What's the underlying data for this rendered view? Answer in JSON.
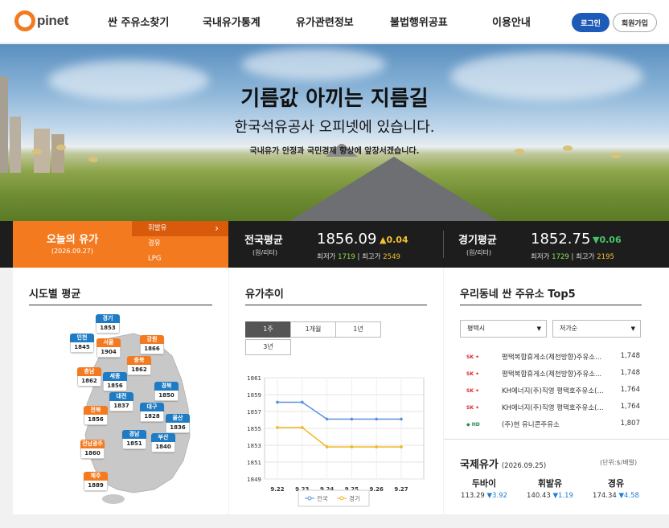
{
  "header": {
    "logo_text": "pinet",
    "nav": [
      "싼 주유소찾기",
      "국내유가통계",
      "유가관련정보",
      "불법행위공표",
      "이용안내"
    ],
    "login_label": "로그인",
    "join_label": "회원가입"
  },
  "hero": {
    "title": "기름값 아끼는 지름길",
    "subtitle": "한국석유공사 오피넷에 있습니다.",
    "caption": "국내유가 안정과 국민경제 향상에 앞장서겠습니다."
  },
  "today": {
    "title": "오늘의 유가",
    "date": "(2026.09.27)",
    "fuel_tabs": [
      "휘발유",
      "경유",
      "LPG"
    ],
    "active_tab": "휘발유",
    "national": {
      "title": "전국평균",
      "unit": "(원/리터)",
      "value": "1856.09",
      "change": "0.04",
      "direction": "up",
      "min_label": "최저가",
      "min": "1719",
      "max_label": "최고가",
      "max": "2549"
    },
    "gyeonggi": {
      "title": "경기평균",
      "unit": "(원/리터)",
      "value": "1852.75",
      "change": "0.06",
      "direction": "down",
      "min_label": "최저가",
      "min": "1729",
      "max_label": "최고가",
      "max": "2195"
    }
  },
  "regions_panel": {
    "title": "시도별 평균",
    "regions": [
      {
        "name": "경기",
        "value": "1853",
        "color": "blue"
      },
      {
        "name": "인천",
        "value": "1845",
        "color": "blue"
      },
      {
        "name": "서울",
        "value": "1904",
        "color": "orange"
      },
      {
        "name": "강원",
        "value": "1866",
        "color": "orange"
      },
      {
        "name": "충북",
        "value": "1862",
        "color": "orange"
      },
      {
        "name": "충남",
        "value": "1862",
        "color": "orange"
      },
      {
        "name": "세종",
        "value": "1856",
        "color": "blue"
      },
      {
        "name": "경북",
        "value": "1850",
        "color": "blue"
      },
      {
        "name": "대전",
        "value": "1837",
        "color": "blue"
      },
      {
        "name": "대구",
        "value": "1828",
        "color": "blue"
      },
      {
        "name": "전북",
        "value": "1856",
        "color": "orange"
      },
      {
        "name": "울산",
        "value": "1836",
        "color": "blue"
      },
      {
        "name": "경남",
        "value": "1851",
        "color": "blue"
      },
      {
        "name": "부산",
        "value": "1840",
        "color": "blue"
      },
      {
        "name": "전남광주",
        "value": "1860",
        "color": "orange"
      },
      {
        "name": "제주",
        "value": "1889",
        "color": "orange"
      }
    ]
  },
  "trend_panel": {
    "title": "유가추이",
    "periods": [
      "1주",
      "1개월",
      "1년",
      "3년"
    ],
    "active_period": "1주"
  },
  "chart_data": {
    "type": "line",
    "x": [
      "9.22",
      "9.23",
      "9.24",
      "9.25",
      "9.26",
      "9.27"
    ],
    "series": [
      {
        "name": "전국",
        "values": [
          1858.1,
          1858.1,
          1856.1,
          1856.1,
          1856.1,
          1856.1
        ],
        "color": "#5b8fe0"
      },
      {
        "name": "경기",
        "values": [
          1855.1,
          1855.1,
          1852.8,
          1852.8,
          1852.8,
          1852.8
        ],
        "color": "#f2b51e"
      }
    ],
    "y_ticks": [
      1861,
      1859,
      1857,
      1855,
      1853,
      1851,
      1849
    ],
    "ylim": [
      1849,
      1861
    ],
    "grid": true,
    "legend": "bottom"
  },
  "top5_panel": {
    "title": "우리동네 싼 주유소 Top5",
    "region_select": "평택시",
    "sort_select": "저가순",
    "stations": [
      {
        "brand": "SK에너지",
        "name": "평택복합휴게소(제천방향)주유소...",
        "price": "1,748"
      },
      {
        "brand": "SK에너지",
        "name": "평택복합휴게소(제천방향)주유소...",
        "price": "1,748"
      },
      {
        "brand": "SK에너지",
        "name": "KH에너지(주)직영 평택호주유소(...",
        "price": "1,764"
      },
      {
        "brand": "SK에너지",
        "name": "KH에너지(주)직영 평택호주유소(...",
        "price": "1,764"
      },
      {
        "brand": "HD현대오일뱅크",
        "name": "(주)현 유니콘주유소",
        "price": "1,807"
      }
    ]
  },
  "intl": {
    "title": "국제유가",
    "date": "(2026.09.25)",
    "unit": "(단위:$/배럴)",
    "items": [
      {
        "name": "두바이",
        "value": "113.29",
        "change": "3.92"
      },
      {
        "name": "휘발유",
        "value": "140.43",
        "change": "1.19"
      },
      {
        "name": "경유",
        "value": "174.34",
        "change": "4.58"
      }
    ]
  }
}
